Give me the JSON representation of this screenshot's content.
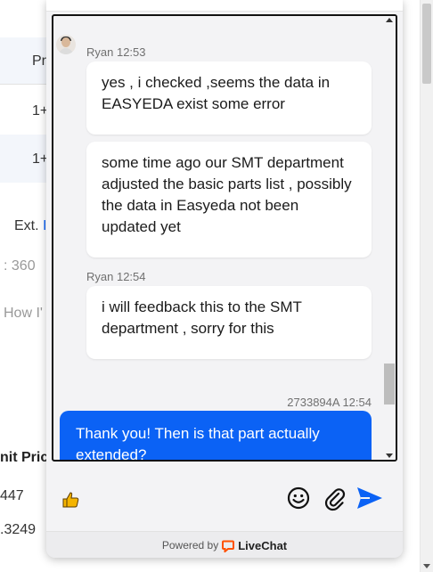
{
  "background": {
    "rows": [
      {
        "text": "Pr"
      },
      {
        "text": "1+"
      },
      {
        "text": "1+"
      }
    ],
    "ext_label": "Ext.",
    "ext_marker": "I",
    "count_text": ": 360",
    "how_text": "How I'",
    "unit_price_header": "nit Pric",
    "price_1": "447",
    "price_2": ".3249"
  },
  "chat": {
    "messages": [
      {
        "author": "Ryan",
        "time": "12:53",
        "meta": "Ryan 12:53",
        "text": "yes ,  i checked ,seems the data in EASYEDA exist some error"
      },
      {
        "text": "some time ago our SMT department adjusted the basic parts list , possibly the data in Easyeda not been updated yet"
      },
      {
        "author": "Ryan",
        "time": "12:54",
        "meta": "Ryan 12:54",
        "text": "i will feedback this to the SMT department , sorry for this"
      },
      {
        "author": "2733894A",
        "time": "12:54",
        "meta": "2733894A 12:54",
        "text": "Thank you! Then is that part actually extended?",
        "outgoing": true
      }
    ],
    "composer": {
      "thumbs_up_icon": "thumbs-up-icon",
      "emoji_icon": "emoji-icon",
      "attach_icon": "paperclip-icon",
      "send_icon": "send-icon"
    },
    "footer": {
      "powered_by": "Powered by",
      "brand": "LiveChat"
    }
  },
  "colors": {
    "accent": "#0b62f5",
    "brand_orange": "#ff5100"
  }
}
